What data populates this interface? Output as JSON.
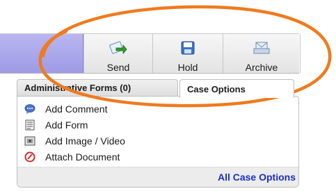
{
  "toolbar": {
    "send_label": "Send",
    "hold_label": "Hold",
    "archive_label": "Archive",
    "send_icon": "send-arrow-icon",
    "hold_icon": "floppy-disk-icon",
    "archive_icon": "envelope-archive-icon"
  },
  "tabs": [
    {
      "label": "Administrative Forms (0)"
    },
    {
      "label": "Case Options"
    }
  ],
  "case_options": {
    "items": [
      {
        "label": "Add Comment",
        "icon": "comment-icon"
      },
      {
        "label": "Add Form",
        "icon": "form-icon"
      },
      {
        "label": "Add Image / Video",
        "icon": "image-video-icon"
      },
      {
        "label": "Attach Document",
        "icon": "attach-document-icon"
      }
    ],
    "all_link": "All Case Options"
  },
  "colors": {
    "annotation": "#f07a1e",
    "link": "#1a2fc4",
    "toolbar_accent": "#a9a5ea"
  }
}
